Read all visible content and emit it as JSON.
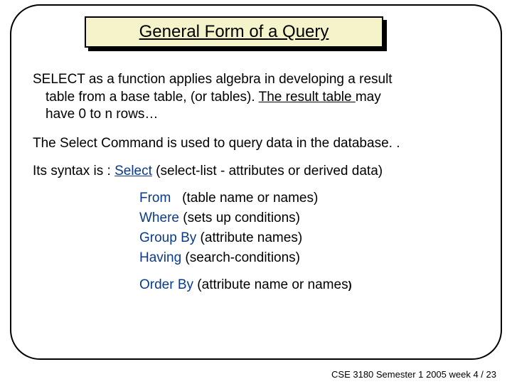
{
  "title": "General Form of a Query",
  "para1_line1": "SELECT as a function applies algebra in developing a result",
  "para1_line2a": "table from a base table, (or tables). ",
  "para1_line2b": "The result table ",
  "para1_line2c": "may",
  "para1_line3": "have 0 to n rows…",
  "para2": "The Select Command is used to query data in the database. .",
  "para3_a": "Its syntax is : ",
  "para3_kw": "Select",
  "para3_b": " (select-list - attributes or derived data)",
  "clauses": [
    {
      "kw": "From",
      "rest": "   (table name or names)"
    },
    {
      "kw": "Where",
      "rest": " (sets up conditions)"
    },
    {
      "kw": "Group By",
      "rest": " (attribute names)"
    },
    {
      "kw": "Having",
      "rest": " (search-conditions)"
    }
  ],
  "orderby_kw": "Order By",
  "orderby_rest": " (attribute name or names",
  "orderby_close": ")",
  "footer": "CSE 3180 Semester 1 2005  week 4 / 23"
}
